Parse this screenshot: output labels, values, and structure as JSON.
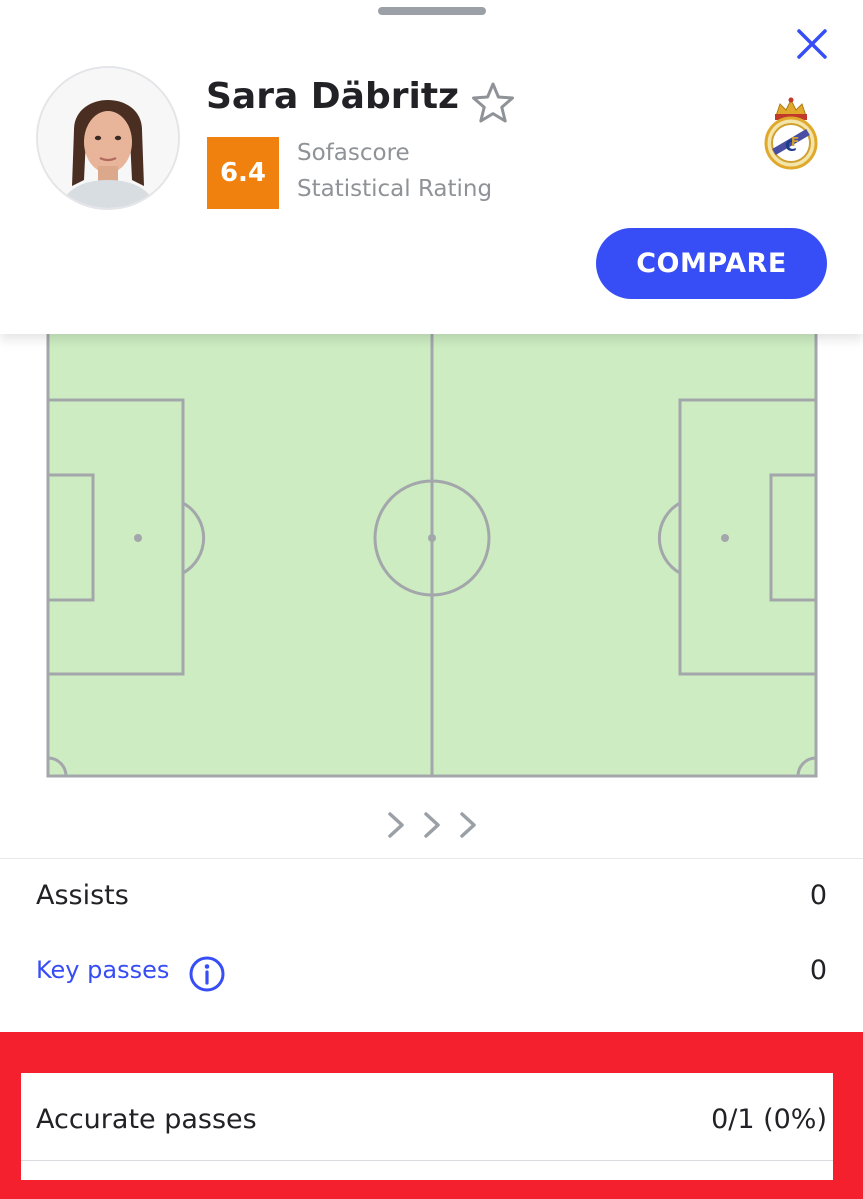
{
  "player": {
    "name": "Sara Däbritz",
    "rating": "6.4",
    "rating_source": "Sofascore",
    "rating_label": "Statistical Rating",
    "team_logo": "real-madrid-crest"
  },
  "actions": {
    "compare_label": "COMPARE",
    "close_icon": "close-icon",
    "favorite_icon": "star-outline-icon"
  },
  "colors": {
    "accent": "#374df5",
    "rating_badge": "#f0810f",
    "pitch_fill": "#cdecc2",
    "pitch_lines": "#a3a6ab",
    "highlight": "#f5202e"
  },
  "stats": [
    {
      "label": "Assists",
      "value": "0"
    },
    {
      "label": "Key passes",
      "value": "0"
    },
    {
      "label": "Accurate passes",
      "value": "0/1 (0%)"
    }
  ]
}
